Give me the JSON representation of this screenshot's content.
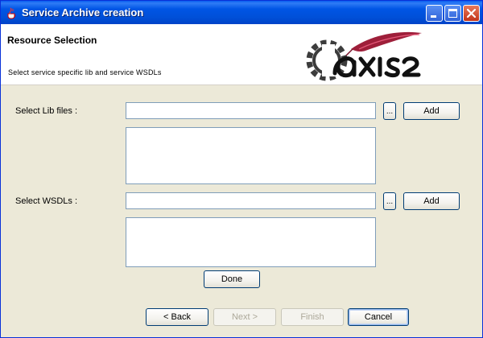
{
  "window": {
    "title": "Service Archive creation",
    "icon": "java-cup-icon",
    "controls": [
      "minimize-icon",
      "maximize-icon",
      "close-icon"
    ]
  },
  "banner": {
    "title": "Resource Selection",
    "subtitle": "Select service specific lib and service WSDLs",
    "logo_text": "AXIS2",
    "logo_icon": "apache-feather-gear-logo"
  },
  "lib": {
    "label": "Select Lib files :",
    "value": "",
    "browse_label": "...",
    "add_label": "Add"
  },
  "wsdl": {
    "label": "Select WSDLs :",
    "value": "",
    "browse_label": "...",
    "add_label": "Add"
  },
  "done_label": "Done",
  "nav": {
    "back": "< Back",
    "next": "Next >",
    "finish": "Finish",
    "cancel": "Cancel"
  },
  "colors": {
    "titlebar": "#0055e5",
    "dialog_bg": "#ece9d8",
    "field_border": "#7f9db9",
    "button_border": "#003c74",
    "close_button": "#c2351a",
    "feather": "#9e1f3a"
  }
}
